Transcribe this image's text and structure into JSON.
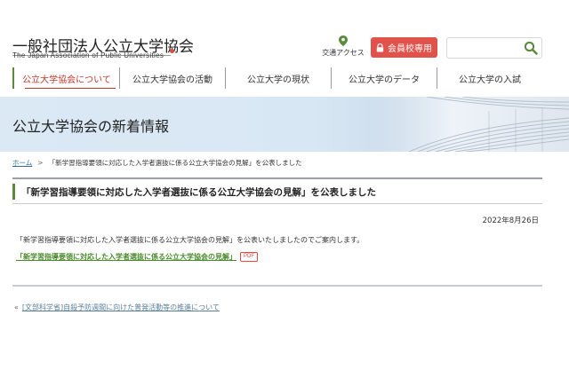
{
  "header": {
    "org_name": "一般社団法人公立大学協会",
    "org_name_en": "The Japan Association of Public Universities",
    "access_label": "交通アクセス",
    "member_button": "会員校専用",
    "search_placeholder": ""
  },
  "nav": {
    "items": [
      {
        "label": "公立大学協会について"
      },
      {
        "label": "公立大学協会の活動"
      },
      {
        "label": "公立大学の現状"
      },
      {
        "label": "公立大学のデータ"
      },
      {
        "label": "公立大学の入試"
      }
    ],
    "active_index": 0
  },
  "banner": {
    "title": "公立大学協会の新着情報"
  },
  "breadcrumb": {
    "home": "ホーム",
    "separator": ">",
    "current": "「新学習指導要領に対応した入学者選抜に係る公立大学協会の見解」を公表しました"
  },
  "article": {
    "title": "「新学習指導要領に対応した入学者選抜に係る公立大学協会の見解」を公表しました",
    "date": "2022年8月26日",
    "body": "「新学習指導要領に対応した入学者選抜に係る公立大学協会の見解」を公表いたしましたのでご案内します。",
    "link_label": "「新学習指導要領に対応した入学者選抜に係る公立大学協会の見解」",
    "badge": "PDF"
  },
  "prev": {
    "arrow": "«",
    "label": "[文部科学省]自殺予防週間に向けた普発活動等の推進について"
  },
  "colors": {
    "accent_red": "#e1524a",
    "accent_green": "#5a8b3b",
    "link_green": "#4a8a2c",
    "link_blue": "#2f6b9a"
  }
}
